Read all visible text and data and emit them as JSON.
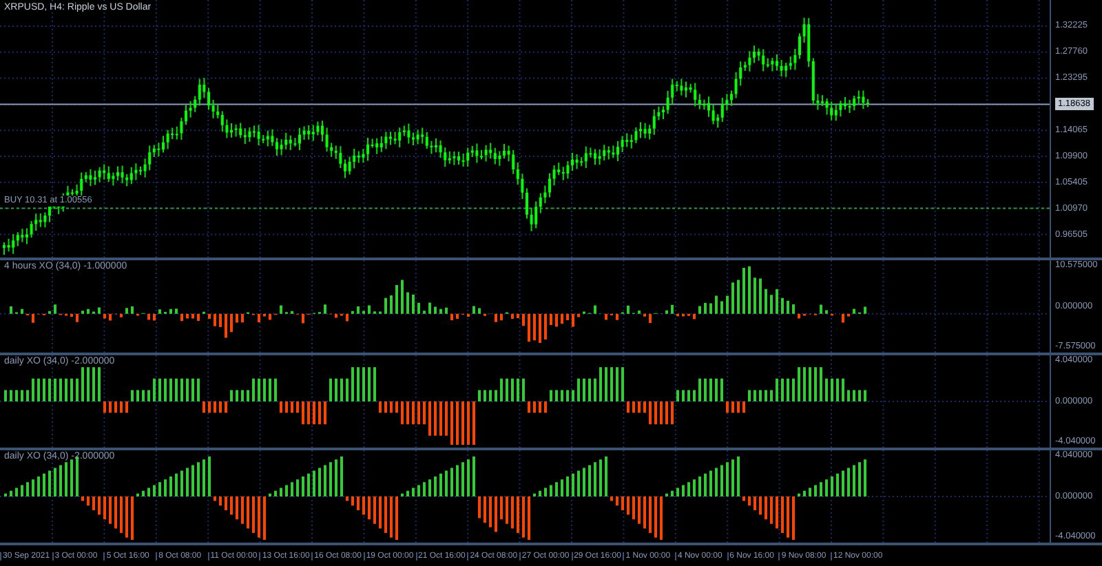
{
  "title": "XRPUSD, H4:  Ripple vs US Dollar",
  "main": {
    "order_label": "BUY 10.31 at 1.00556",
    "price_axis": [
      {
        "text": "1.32225",
        "kind": "tick"
      },
      {
        "text": "1.27760",
        "kind": "tick"
      },
      {
        "text": "1.23295",
        "kind": "tick"
      },
      {
        "text": "1.18638",
        "kind": "current"
      },
      {
        "text": "1.14065",
        "kind": "tick"
      },
      {
        "text": "1.09900",
        "kind": "tick"
      },
      {
        "text": "1.05405",
        "kind": "tick"
      },
      {
        "text": "1.00970",
        "kind": "tick"
      },
      {
        "text": "0.96505",
        "kind": "tick"
      }
    ]
  },
  "indicators": [
    {
      "label": "4 hours XO (34,0) -1.000000",
      "axis": [
        "10.575000",
        "0.000000",
        "-7.575000"
      ]
    },
    {
      "label": "daily XO (34,0) -2.000000",
      "axis": [
        "4.040000",
        "0.000000",
        "-4.040000"
      ]
    },
    {
      "label": "daily XO (34,0) -2.000000",
      "axis": [
        "4.040000",
        "0.000000",
        "-4.040000"
      ]
    }
  ],
  "time_axis": [
    "30 Sep 2021",
    "3 Oct 00:00",
    "5 Oct 16:00",
    "8 Oct 08:00",
    "11 Oct 00:00",
    "13 Oct 16:00",
    "16 Oct 08:00",
    "19 Oct 00:00",
    "21 Oct 16:00",
    "24 Oct 08:00",
    "27 Oct 00:00",
    "29 Oct 16:00",
    "1 Nov 00:00",
    "4 Nov 00:00",
    "6 Nov 16:00",
    "9 Nov 08:00",
    "12 Nov 00:00"
  ]
}
